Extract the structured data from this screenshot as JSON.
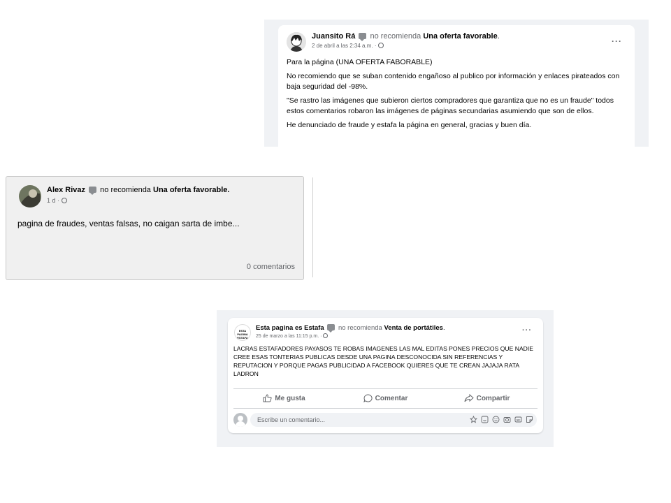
{
  "post1": {
    "author": "Juansito Rá",
    "verb": "no recomienda",
    "page": "Una oferta favorable",
    "period": ".",
    "date": "2 de abril a las 2:34 a.m. ·",
    "menu": "···",
    "paragraphs": [
      "Para la página (UNA OFERTA FABORABLE)",
      "No recomiendo que se suban contenido engañoso al publico por información y enlaces pirateados con baja seguridad del -98%.",
      "\"Se rastro las imágenes que subieron ciertos compradores que garantiza que no es un fraude\" todos estos comentarios robaron las imágenes de páginas secundarias asumiendo que son de ellos.",
      "He denunciado de fraude y estafa la página en general, gracias y buen día."
    ]
  },
  "post2": {
    "author": "Alex Rivaz",
    "verb": "no recomienda",
    "page": "Una oferta favorable.",
    "date": "1 d ·",
    "body": "pagina de fraudes, ventas falsas, no caigan sarta de imbe...",
    "comments": "0 comentarios"
  },
  "post3": {
    "avatar_text": "ESTA PAGINA ESTAFA",
    "author": "Esta pagina es Estafa",
    "verb": "no recomienda",
    "page": "Venta de portátiles",
    "period": ".",
    "date": "25 de marzo a las 11:15 p.m. ·",
    "menu": "···",
    "body": "LACRAS ESTAFADORES PAYASOS TE ROBAS IMAGENES LAS MAL EDITAS PONES PRECIOS QUE NADIE CREE ESAS TONTERIAS PUBLICAS DESDE UNA PAGINA DESCONOCIDA SIN REFERENCIAS Y REPUTACION Y PORQUE PAGAS PUBLICIDAD A FACEBOOK QUIERES QUE TE CREAN JAJAJA RATA LADRON",
    "actions": {
      "like": "Me gusta",
      "comment": "Comentar",
      "share": "Compartir"
    },
    "comment_placeholder": "Escribe un comentario..."
  }
}
